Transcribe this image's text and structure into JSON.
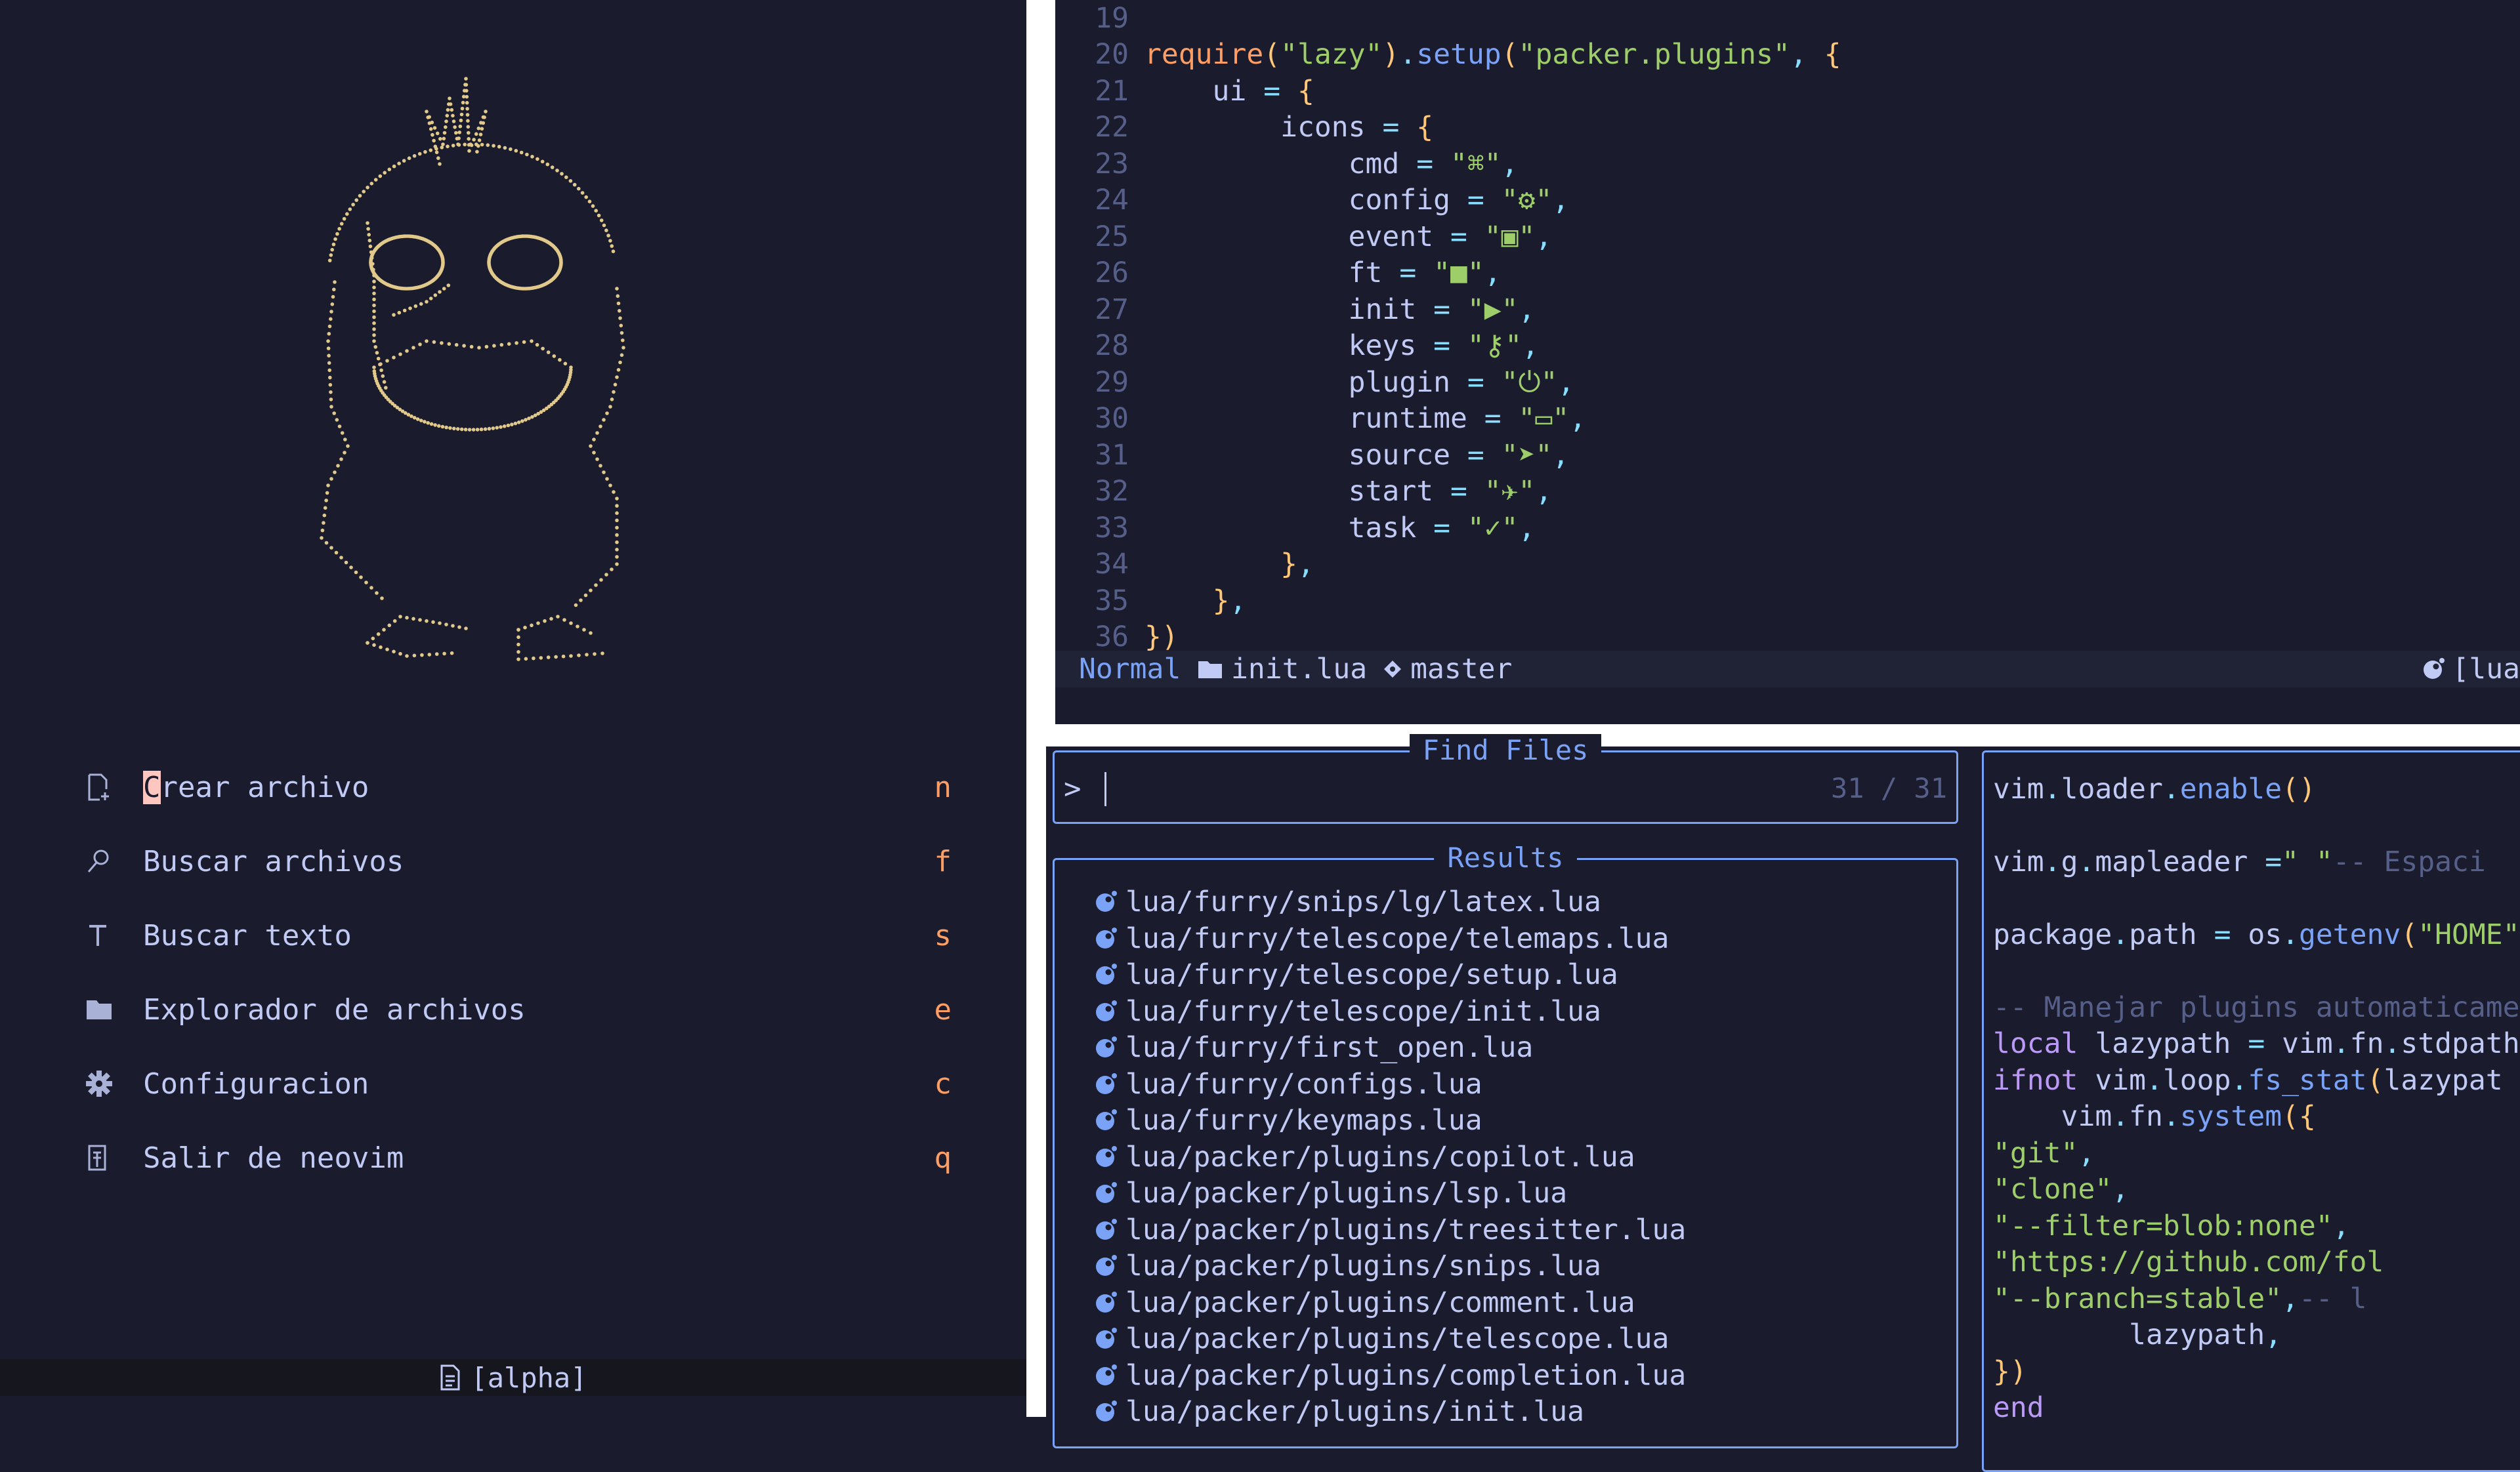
{
  "dashboard": {
    "menu": [
      {
        "icon": "file-plus-icon",
        "label": "Crear archivo",
        "key": "n"
      },
      {
        "icon": "search-icon",
        "label": "Buscar archivos",
        "key": "f"
      },
      {
        "icon": "text-icon",
        "label": "Buscar texto",
        "key": "s"
      },
      {
        "icon": "folder-icon",
        "label": "Explorador de archivos",
        "key": "e"
      },
      {
        "icon": "gear-icon",
        "label": "Configuracion",
        "key": "c"
      },
      {
        "icon": "exit-icon",
        "label": "Salir de neovim",
        "key": "q"
      }
    ],
    "buffer_name": "[alpha]"
  },
  "editor": {
    "lines": [
      {
        "n": "19",
        "text": ""
      },
      {
        "n": "20",
        "text": "require(\"lazy\").setup(\"packer.plugins\", {"
      },
      {
        "n": "21",
        "text": "    ui = {"
      },
      {
        "n": "22",
        "text": "        icons = {"
      },
      {
        "n": "23",
        "text": "            cmd = \"⌘\","
      },
      {
        "n": "24",
        "text": "            config = \"⚙\","
      },
      {
        "n": "25",
        "text": "            event = \"▣\","
      },
      {
        "n": "26",
        "text": "            ft = \"■\","
      },
      {
        "n": "27",
        "text": "            init = \"▶\","
      },
      {
        "n": "28",
        "text": "            keys = \"⚷\","
      },
      {
        "n": "29",
        "text": "            plugin = \"⏻\","
      },
      {
        "n": "30",
        "text": "            runtime = \"▭\","
      },
      {
        "n": "31",
        "text": "            source = \"➤\","
      },
      {
        "n": "32",
        "text": "            start = \"✈\","
      },
      {
        "n": "33",
        "text": "            task = \"✓\","
      },
      {
        "n": "34",
        "text": "        },"
      },
      {
        "n": "35",
        "text": "    },"
      },
      {
        "n": "36",
        "text": "})"
      }
    ],
    "status": {
      "mode": "Normal",
      "file": "init.lua",
      "branch": "master",
      "right": "[lua"
    }
  },
  "telescope": {
    "prompt_title": "Find Files",
    "prompt_symbol": ">",
    "count": "31 / 31",
    "results_title": "Results",
    "results": [
      "lua/furry/snips/lg/latex.lua",
      "lua/furry/telescope/telemaps.lua",
      "lua/furry/telescope/setup.lua",
      "lua/furry/telescope/init.lua",
      "lua/furry/first_open.lua",
      "lua/furry/configs.lua",
      "lua/furry/keymaps.lua",
      "lua/packer/plugins/copilot.lua",
      "lua/packer/plugins/lsp.lua",
      "lua/packer/plugins/treesitter.lua",
      "lua/packer/plugins/snips.lua",
      "lua/packer/plugins/comment.lua",
      "lua/packer/plugins/telescope.lua",
      "lua/packer/plugins/completion.lua",
      "lua/packer/plugins/init.lua"
    ],
    "preview": [
      "vim.loader.enable()",
      "",
      "vim.g.mapleader = \" \" -- Espaci",
      "",
      "package.path = os.getenv(\"HOME\"",
      "",
      "-- Manejar plugins automaticame",
      "local lazypath = vim.fn.stdpath",
      "if not vim.loop.fs_stat(lazypat",
      "    vim.fn.system({",
      "        \"git\",",
      "        \"clone\",",
      "        \"--filter=blob:none\",",
      "        \"https://github.com/fol",
      "        \"--branch=stable\", -- l",
      "        lazypath,",
      "    })",
      "end"
    ]
  },
  "colors": {
    "background": "#1a1b2c",
    "accent": "#7aa2f7",
    "string": "#9ece6a",
    "keyword": "#ff9e64",
    "art": "#e0c98a"
  }
}
